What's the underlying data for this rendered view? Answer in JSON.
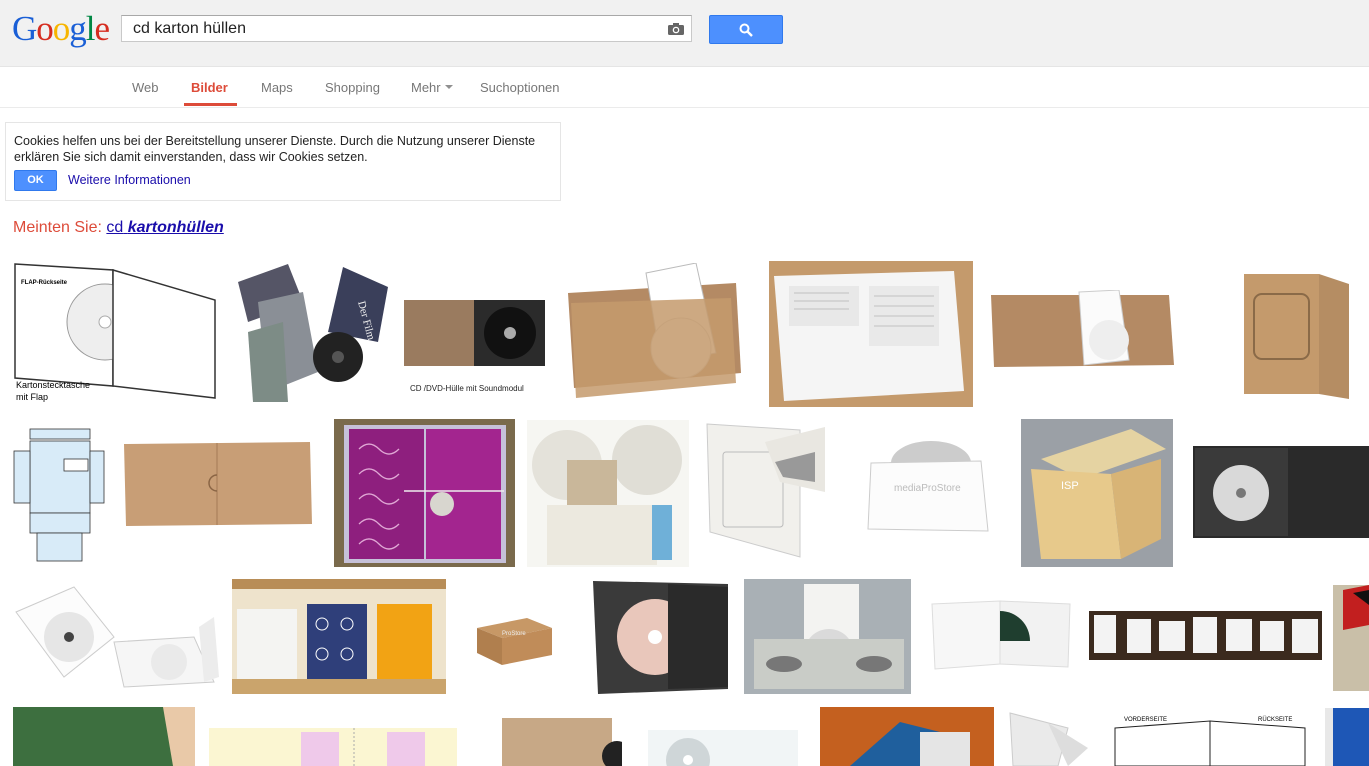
{
  "logo": {
    "letters": [
      "G",
      "o",
      "o",
      "g",
      "l",
      "e"
    ],
    "colors": [
      "#1a5fd6",
      "#d62d20",
      "#f7b500",
      "#1a5fd6",
      "#008744",
      "#d62d20"
    ]
  },
  "search": {
    "query": "cd karton hüllen",
    "camera_icon": "camera-icon",
    "button_icon": "magnifier-icon"
  },
  "nav": {
    "tabs": [
      {
        "label": "Web",
        "active": false
      },
      {
        "label": "Bilder",
        "active": true
      },
      {
        "label": "Maps",
        "active": false
      },
      {
        "label": "Shopping",
        "active": false
      },
      {
        "label": "Mehr",
        "active": false
      },
      {
        "label": "Suchoptionen",
        "active": false
      }
    ]
  },
  "cookie": {
    "text": "Cookies helfen uns bei der Bereitstellung unserer Dienste. Durch die Nutzung unserer Dienste erklären Sie sich damit einverstanden, dass wir Cookies setzen.",
    "ok_label": "OK",
    "more_label": "Weitere Informationen"
  },
  "did_you_mean": {
    "prefix": "Meinten Sie:",
    "plain": "cd",
    "bold": "kartonhüllen"
  },
  "thumb_texts": {
    "flap_title": "FLAP-Rückseite",
    "flap_caption_1": "Kartonstecktasche",
    "flap_caption_2": "mit Flap",
    "soundmodul": "CD /DVD-Hülle mit Soundmodul",
    "mediaprostore": "mediaProStore",
    "isp": "ISP",
    "prostore": "ProStore",
    "der_film": "Der Film",
    "vorderseite": "VORDERSEITE",
    "rueckseite": "RÜCKSEITE"
  },
  "colors": {
    "accent": "#dd4b39",
    "link": "#1a0dab",
    "button": "#4d90fe",
    "kraft": "#c49a6c"
  }
}
